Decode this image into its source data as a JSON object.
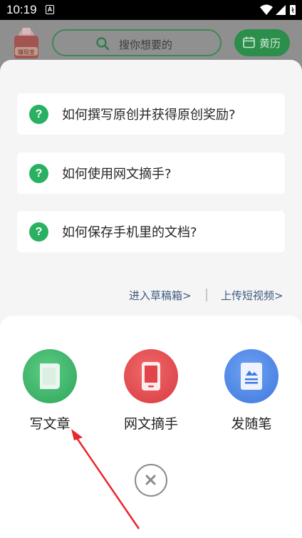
{
  "status_bar": {
    "time": "10:19",
    "notification_letter": "A"
  },
  "topbar": {
    "envelope_label": "赚现金",
    "search_placeholder": "搜你想要的",
    "calendar_label": "黄历"
  },
  "faq": [
    {
      "text": "如何撰写原创并获得原创奖励?"
    },
    {
      "text": "如何使用网文摘手?"
    },
    {
      "text": "如何保存手机里的文档?"
    }
  ],
  "faq_icon_glyph": "?",
  "links": {
    "drafts": "进入草稿箱>",
    "upload_video": "上传短视频>"
  },
  "actions": [
    {
      "label": "写文章",
      "icon": "document-icon",
      "color": "#38b465"
    },
    {
      "label": "网文摘手",
      "icon": "phone-icon",
      "color": "#e2444a"
    },
    {
      "label": "发随笔",
      "icon": "note-image-icon",
      "color": "#4a86e6"
    }
  ],
  "annotation_color": "#e8262d"
}
